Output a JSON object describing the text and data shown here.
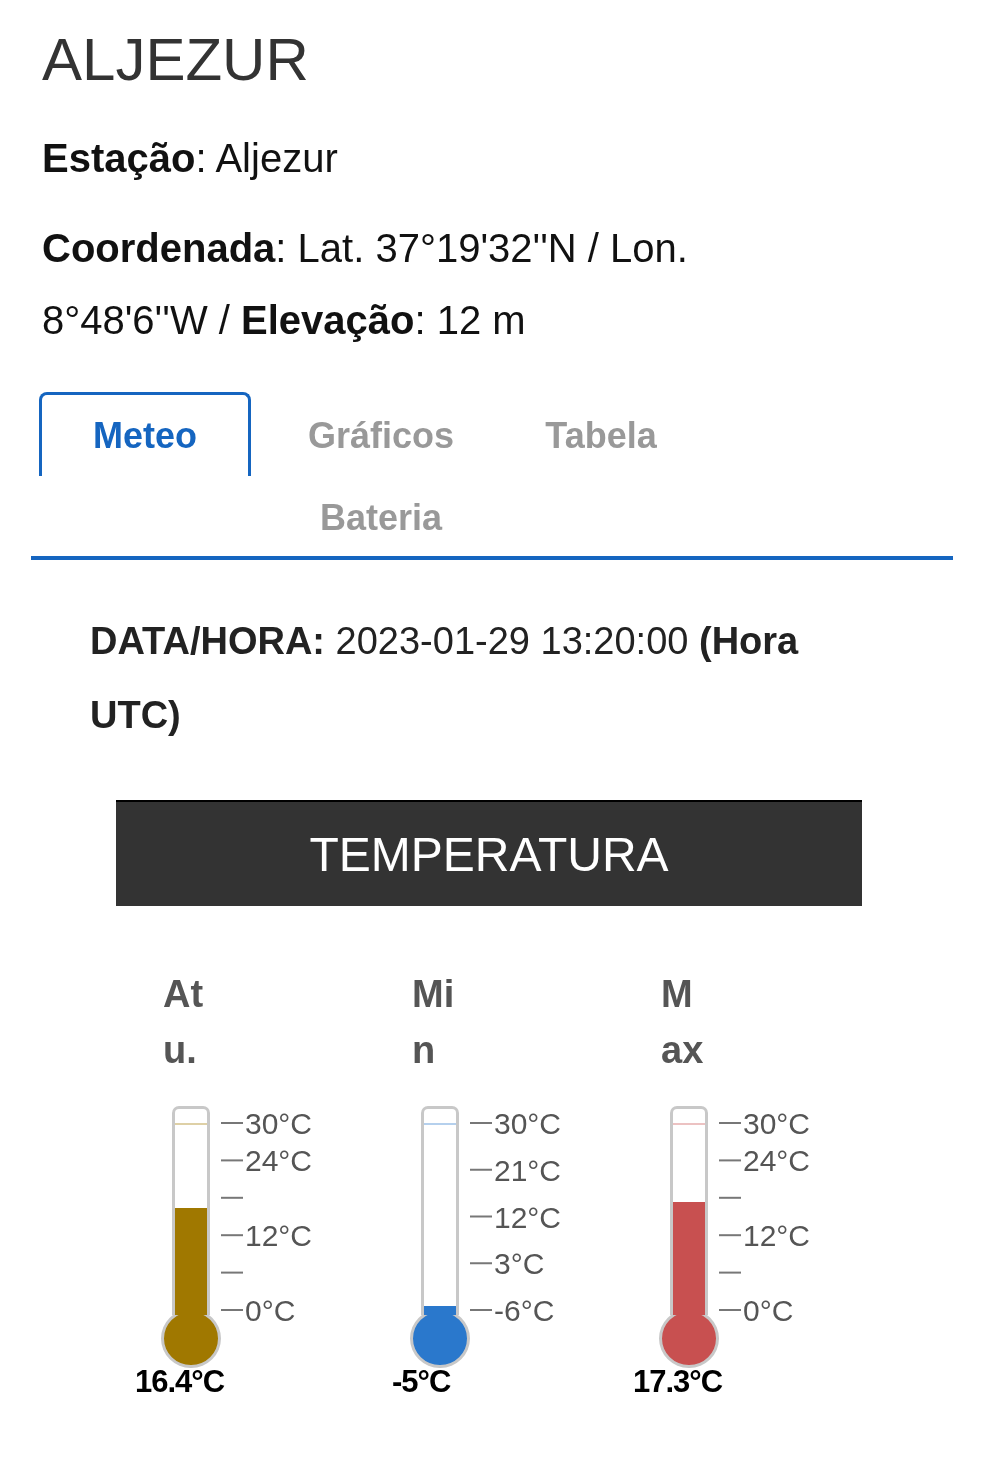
{
  "title": "ALJEZUR",
  "station": "**Estação**: Aljezur",
  "coordinates": "**Coordenada**: Lat. 37°19'32''N / Lon. 8°48'6''W / **Elevação**: 12 m",
  "tabs": [
    {
      "label": "Meteo",
      "selected": true
    },
    {
      "label": "Gráficos",
      "selected": false
    },
    {
      "label": "Tabela",
      "selected": false
    },
    {
      "label": "Bateria",
      "selected": false
    }
  ],
  "datetime": "**DATA/HORA:** 2023-01-29 13:20:00 **(Hora UTC)**",
  "section_title": "TEMPERATURA",
  "gauges": [
    {
      "label": "Atu.",
      "value": "16.4°C",
      "level": 0.52,
      "color": "#a07800",
      "ticks": [
        {
          "kind": "major",
          "label": "30°C"
        },
        {
          "kind": "major",
          "label": "24°C"
        },
        {
          "kind": "minor"
        },
        {
          "kind": "major",
          "label": "12°C"
        },
        {
          "kind": "minor"
        },
        {
          "kind": "major",
          "label": "0°C"
        }
      ]
    },
    {
      "label": "Min",
      "value": "-5°C",
      "level": 0.04,
      "color": "#2a78cc",
      "ticks": [
        {
          "kind": "major",
          "label": "30°C"
        },
        {
          "kind": "major",
          "label": "21°C"
        },
        {
          "kind": "major",
          "label": "12°C"
        },
        {
          "kind": "major",
          "label": "3°C"
        },
        {
          "kind": "major",
          "label": "-6°C"
        }
      ]
    },
    {
      "label": "Max",
      "value": "17.3°C",
      "level": 0.55,
      "color": "#c85050",
      "ticks": [
        {
          "kind": "major",
          "label": "30°C"
        },
        {
          "kind": "major",
          "label": "24°C"
        },
        {
          "kind": "minor"
        },
        {
          "kind": "major",
          "label": "12°C"
        },
        {
          "kind": "minor"
        },
        {
          "kind": "major",
          "label": "0°C"
        }
      ]
    }
  ]
}
